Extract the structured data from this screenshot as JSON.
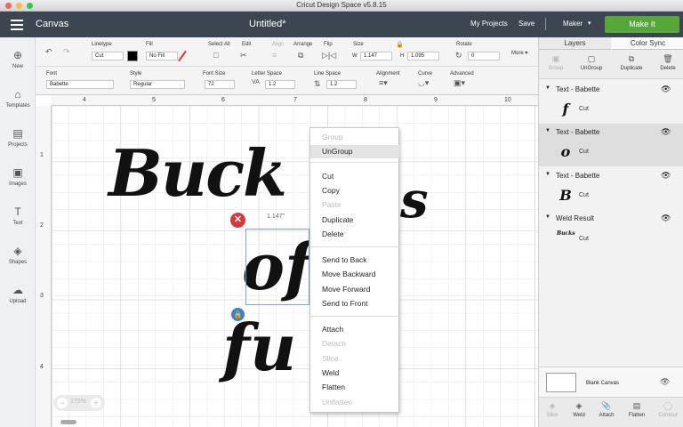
{
  "window": {
    "title": "Cricut Design Space  v5.8.15"
  },
  "appbar": {
    "section": "Canvas",
    "document": "Untitled*",
    "my_projects": "My Projects",
    "save": "Save",
    "separator": "|",
    "machine": "Maker",
    "make_it": "Make It"
  },
  "toolbar": {
    "undo_icon": "undo-icon",
    "redo_icon": "redo-icon",
    "linetype_label": "Linetype",
    "linetype_value": "Cut",
    "fill_label": "Fill",
    "fill_value": "No Fill",
    "select_all_label": "Select All",
    "edit_label": "Edit",
    "align_label": "Align",
    "arrange_label": "Arrange",
    "flip_label": "Flip",
    "size_label": "Size",
    "w_label": "W",
    "w_value": "1.147",
    "h_label": "H",
    "h_value": "1.095",
    "rotate_label": "Rotate",
    "rotate_value": "0",
    "more_label": "More ▾",
    "font_label": "Font",
    "font_value": "Babette",
    "style_label": "Style",
    "style_value": "Regular",
    "font_size_label": "Font Size",
    "font_size_value": "72",
    "letter_space_label": "Letter Space",
    "letter_space_value": "1.2",
    "line_space_label": "Line Space",
    "line_space_value": "1.2",
    "alignment_label": "Alignment",
    "curve_label": "Curve",
    "advanced_label": "Advanced"
  },
  "leftnav": [
    {
      "label": "New",
      "icon": "⊕"
    },
    {
      "label": "Templates",
      "icon": "⌂"
    },
    {
      "label": "Projects",
      "icon": "▤"
    },
    {
      "label": "Images",
      "icon": "▣"
    },
    {
      "label": "Text",
      "icon": "T"
    },
    {
      "label": "Shapes",
      "icon": "◈"
    },
    {
      "label": "Upload",
      "icon": "☁"
    }
  ],
  "rulers": {
    "top": [
      "4",
      "5",
      "6",
      "7",
      "8",
      "9",
      "10"
    ],
    "left": [
      "1",
      "2",
      "3",
      "4"
    ]
  },
  "canvas": {
    "line1": "Buck",
    "line1b": "s",
    "line2": "of",
    "line3": "fu",
    "selection_width": "1.147\"",
    "zoom": "175%"
  },
  "context_menu": {
    "items": [
      {
        "label": "Group",
        "enabled": false
      },
      {
        "label": "UnGroup",
        "enabled": true,
        "highlighted": true
      },
      {
        "label": "Cut",
        "enabled": true
      },
      {
        "label": "Copy",
        "enabled": true
      },
      {
        "label": "Paste",
        "enabled": false
      },
      {
        "label": "Duplicate",
        "enabled": true
      },
      {
        "label": "Delete",
        "enabled": true
      },
      {
        "label": "Send to Back",
        "enabled": true
      },
      {
        "label": "Move Backward",
        "enabled": true
      },
      {
        "label": "Move Forward",
        "enabled": true
      },
      {
        "label": "Send to Front",
        "enabled": true
      },
      {
        "label": "Attach",
        "enabled": true
      },
      {
        "label": "Detach",
        "enabled": false
      },
      {
        "label": "Slice",
        "enabled": false
      },
      {
        "label": "Weld",
        "enabled": true
      },
      {
        "label": "Flatten",
        "enabled": true
      },
      {
        "label": "Unflatten",
        "enabled": false
      }
    ]
  },
  "panel": {
    "tab_layers": "Layers",
    "tab_color_sync": "Color Sync",
    "actions": {
      "group": "Group",
      "ungroup": "UnGroup",
      "duplicate": "Duplicate",
      "delete": "Delete"
    },
    "layers": [
      {
        "name": "Text - Babette",
        "op": "Cut",
        "glyph": "f"
      },
      {
        "name": "Text - Babette",
        "op": "Cut",
        "glyph": "o"
      },
      {
        "name": "Text - Babette",
        "op": "Cut",
        "glyph": "B"
      },
      {
        "name": "Weld Result",
        "op": "Cut",
        "glyph": "Bucks"
      }
    ],
    "blank_canvas": "Blank Canvas",
    "bottom": {
      "slice": "Slice",
      "weld": "Weld",
      "attach": "Attach",
      "flatten": "Flatten",
      "contour": "Contour"
    }
  },
  "colors": {
    "appbar": "#3c4651",
    "make_it": "#56a63a",
    "selection": "#7aa7d6",
    "delete_badge": "#d9373a",
    "lock_badge": "#3f7fc4"
  }
}
